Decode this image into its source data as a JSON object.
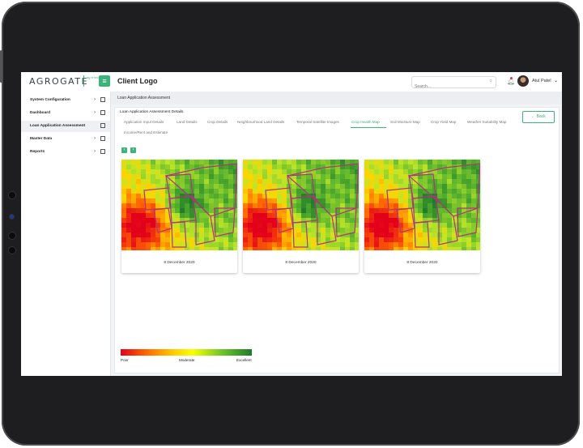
{
  "header": {
    "logo_text": "AGROGATE",
    "logo_sub": "ag·ri·tech",
    "client_logo": "Client Logo",
    "search_placeholder": "Search...",
    "user_name": "Atul Patel"
  },
  "sidebar": {
    "items": [
      {
        "label": "System Configuration",
        "icon": "settings-icon"
      },
      {
        "label": "Dashboard",
        "icon": "grid-icon"
      },
      {
        "label": "Loan Application Assessment",
        "icon": "document-icon"
      },
      {
        "label": "Master Data",
        "icon": "table-icon"
      },
      {
        "label": "Reports",
        "icon": "report-icon"
      }
    ]
  },
  "breadcrumb": "Loan Application Assessment",
  "section_title": "Loan Application Assessment Details",
  "tabs": [
    "Application Input Details",
    "Land Details",
    "Crop Details",
    "Neighbourhood Land Details",
    "Temporal Satellite Images",
    "Crop Health Map",
    "Soil Moisture Map",
    "Crop Yield Map",
    "Weather Suitability Map",
    "Income/Rent and Estimate"
  ],
  "active_tab": "Crop Health Map",
  "back_label": "Back",
  "maps": [
    {
      "date": "8 December 2020"
    },
    {
      "date": "8 December 2020"
    },
    {
      "date": "8 December 2020"
    }
  ],
  "legend": {
    "poor": "Poor",
    "moderate": "Moderate",
    "excellent": "Excellent"
  },
  "colors": {
    "accent": "#3bb37a",
    "poor": "#e3001b",
    "excellent": "#1f7a2a"
  }
}
